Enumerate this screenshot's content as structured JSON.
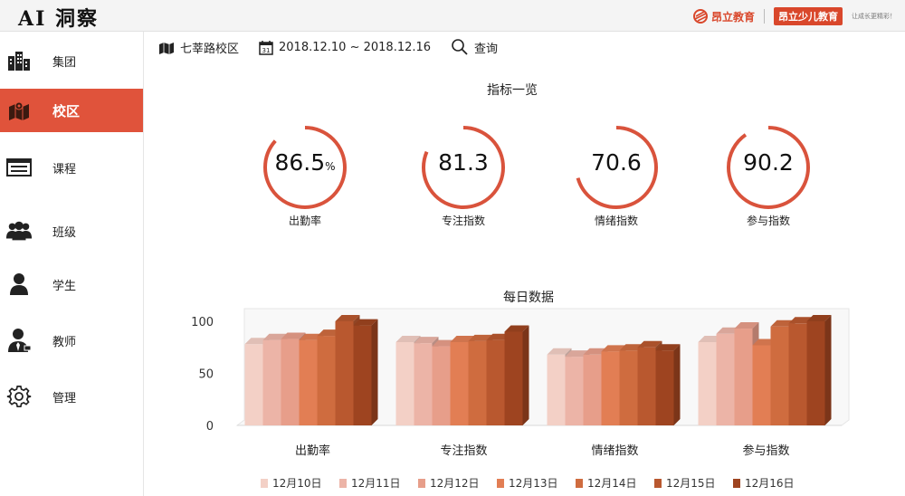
{
  "app": {
    "title": "AI 洞察"
  },
  "brand": {
    "logo_text": "昂立教育",
    "badge": "昂立少儿教育",
    "slogan": "让成长更精彩！",
    "accent_color": "#d9472b"
  },
  "sidebar": {
    "items": [
      {
        "label": "集团",
        "icon": "buildings-icon",
        "active": false
      },
      {
        "label": "校区",
        "icon": "map-icon",
        "active": true
      },
      {
        "label": "课程",
        "icon": "course-panel-icon",
        "active": false
      },
      {
        "label": "班级",
        "icon": "group-icon",
        "active": false
      },
      {
        "label": "学生",
        "icon": "person-icon",
        "active": false
      },
      {
        "label": "教师",
        "icon": "teacher-icon",
        "active": false
      },
      {
        "label": "管理",
        "icon": "gear-icon",
        "active": false
      }
    ],
    "active_color": "#e0533b"
  },
  "filters": {
    "campus": "七莘路校区",
    "date_range": "2018.12.10 ~ 2018.12.16",
    "query_label": "查询"
  },
  "kpi": {
    "title": "指标一览",
    "items": [
      {
        "value": "86.5",
        "unit": "%",
        "label": "出勤率",
        "fraction": 0.865
      },
      {
        "value": "81.3",
        "unit": "",
        "label": "专注指数",
        "fraction": 0.813
      },
      {
        "value": "70.6",
        "unit": "",
        "label": "情绪指数",
        "fraction": 0.706
      },
      {
        "value": "90.2",
        "unit": "",
        "label": "参与指数",
        "fraction": 0.902
      }
    ],
    "ring_color": "#d9533c"
  },
  "chart_data": {
    "type": "bar",
    "title": "每日数据",
    "categories": [
      "出勤率",
      "专注指数",
      "情绪指数",
      "参与指数"
    ],
    "series": [
      {
        "name": "12月10日",
        "color": "#f3d0c6",
        "values": [
          78,
          80,
          68,
          80
        ]
      },
      {
        "name": "12月11日",
        "color": "#ecb4a7",
        "values": [
          82,
          79,
          66,
          88
        ]
      },
      {
        "name": "12月12日",
        "color": "#e79e8a",
        "values": [
          83,
          76,
          68,
          93
        ]
      },
      {
        "name": "12月13日",
        "color": "#e27e54",
        "values": [
          82,
          80,
          71,
          77
        ]
      },
      {
        "name": "12月14日",
        "color": "#cf6c3f",
        "values": [
          86,
          81,
          72,
          95
        ]
      },
      {
        "name": "12月15日",
        "color": "#b9582f",
        "values": [
          100,
          82,
          75,
          98
        ]
      },
      {
        "name": "12月16日",
        "color": "#9e4420",
        "values": [
          96,
          90,
          72,
          100
        ]
      }
    ],
    "ylim": [
      0,
      100
    ],
    "yticks": [
      0,
      50,
      100
    ],
    "legend": "bottom",
    "grid": false
  }
}
